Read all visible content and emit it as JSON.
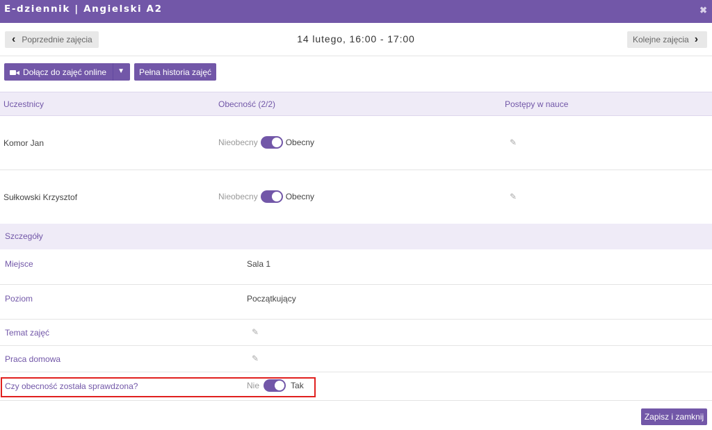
{
  "window": {
    "title": "E-dziennik | Angielski A2",
    "close_icon": "✖"
  },
  "nav": {
    "prev_label": "Poprzednie zajęcia",
    "next_label": "Kolejne zajęcia",
    "date_range": "14 lutego, 16:00 - 17:00"
  },
  "actions": {
    "join_label": "Dołącz do zajęć online",
    "history_label": "Pełna historia zajęć"
  },
  "participants": {
    "headers": {
      "name": "Uczestnicy",
      "attendance": "Obecność (2/2)",
      "progress": "Postępy w nauce"
    },
    "rows": [
      {
        "name": "Komor Jan",
        "absent_label": "Nieobecny",
        "present_label": "Obecny",
        "present": true
      },
      {
        "name": "Sułkowski Krzysztof",
        "absent_label": "Nieobecny",
        "present_label": "Obecny",
        "present": true
      }
    ]
  },
  "details": {
    "title": "Szczegóły",
    "place": {
      "label": "Miejsce",
      "value": "Sala 1"
    },
    "level": {
      "label": "Poziom",
      "value": "Początkujący"
    },
    "topic": {
      "label": "Temat zajęć"
    },
    "homework": {
      "label": "Praca domowa"
    },
    "attendance_checked": {
      "label": "Czy obecność została sprawdzona?",
      "no_label": "Nie",
      "yes_label": "Tak",
      "value": true
    }
  },
  "footer": {
    "save_label": "Zapisz i zamknij"
  },
  "colors": {
    "accent": "#7257a8",
    "header_bg": "#efebf7",
    "highlight": "#e0201e"
  },
  "icons": {
    "prev": "chevron-left-icon",
    "next": "chevron-right-icon",
    "camera": "video-camera-icon",
    "dropdown": "chevron-down-icon",
    "edit": "pencil-icon",
    "close": "close-icon"
  }
}
